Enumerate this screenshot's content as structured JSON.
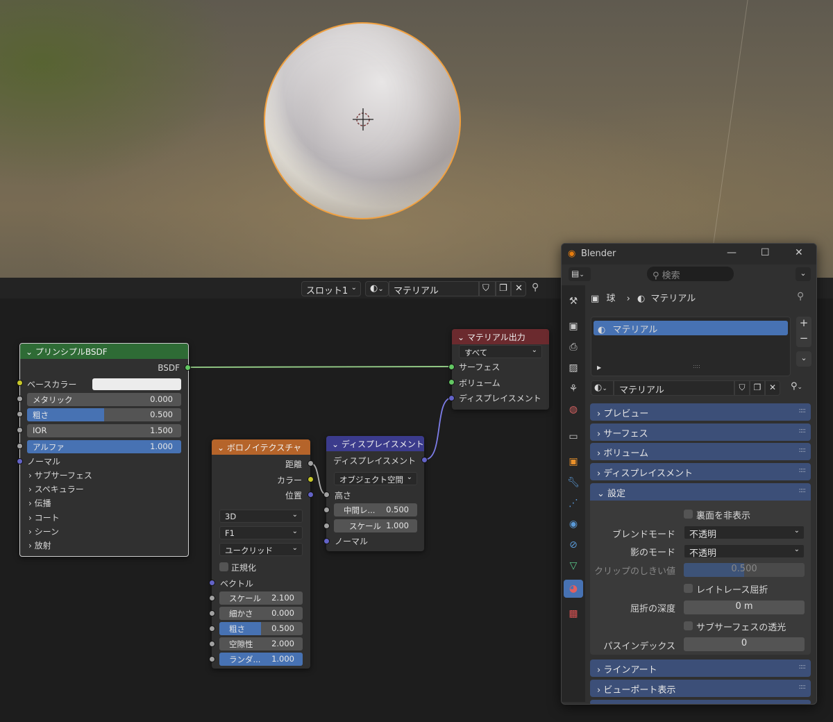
{
  "viewport": {
    "object": "sphere"
  },
  "editor_header": {
    "slot": "スロット1",
    "material": "マテリアル"
  },
  "principled": {
    "title": "プリンシプルBSDF",
    "output": "BSDF",
    "base_color": "ベースカラー",
    "metallic": {
      "label": "メタリック",
      "value": "0.000",
      "fraction": 0
    },
    "roughness": {
      "label": "粗さ",
      "value": "0.500",
      "fraction": 0.5
    },
    "ior": {
      "label": "IOR",
      "value": "1.500"
    },
    "alpha": {
      "label": "アルファ",
      "value": "1.000",
      "fraction": 1
    },
    "normal": "ノーマル",
    "subsections": [
      "サブサーフェス",
      "スペキュラー",
      "伝播",
      "コート",
      "シーン",
      "放射"
    ]
  },
  "output_node": {
    "title": "マテリアル出力",
    "target": "すべて",
    "inputs": [
      "サーフェス",
      "ボリューム",
      "ディスプレイスメント"
    ]
  },
  "voronoi": {
    "title": "ボロノイテクスチャ",
    "outputs": [
      "距離",
      "カラー",
      "位置"
    ],
    "dims": "3D",
    "feature": "F1",
    "metric": "ユークリッド",
    "normalize": "正規化",
    "vector": "ベクトル",
    "fields": [
      {
        "label": "スケール",
        "value": "2.100"
      },
      {
        "label": "細かさ",
        "value": "0.000"
      },
      {
        "label": "粗さ",
        "value": "0.500",
        "fraction": 0.5
      },
      {
        "label": "空隙性",
        "value": "2.000"
      },
      {
        "label": "ランダ...",
        "value": "1.000",
        "fraction": 1
      }
    ]
  },
  "displacement": {
    "title": "ディスプレイスメント",
    "output": "ディスプレイスメント",
    "space": "オブジェクト空間",
    "height": "高さ",
    "midlevel": {
      "label": "中間レ...",
      "value": "0.500"
    },
    "scale": {
      "label": "スケール",
      "value": "1.000"
    },
    "normal": "ノーマル"
  },
  "props": {
    "window_title": "Blender",
    "search_placeholder": "検索",
    "breadcrumb_object": "球",
    "breadcrumb_material": "マテリアル",
    "slot_item": "マテリアル",
    "material_name": "マテリアル",
    "panels": [
      "プレビュー",
      "サーフェス",
      "ボリューム",
      "ディスプレイスメント",
      "設定",
      "ラインアート",
      "ビューポート表示"
    ],
    "settings": {
      "backface": "裏面を非表示",
      "blend_label": "ブレンドモード",
      "blend_value": "不透明",
      "shadow_label": "影のモード",
      "shadow_value": "不透明",
      "clip_label": "クリップのしきい値",
      "clip_value": "0.500",
      "raytrace": "レイトレース屈折",
      "refr_label": "屈折の深度",
      "refr_value": "0 m",
      "sss": "サブサーフェスの透光",
      "pass_label": "パスインデックス",
      "pass_value": "0"
    }
  },
  "colors": {
    "bsdf_header": "#2e6b35",
    "output_header": "#6b2a2e",
    "texture_header": "#b5642a",
    "vector_header": "#3b3b8c",
    "accent": "#4772b3"
  }
}
